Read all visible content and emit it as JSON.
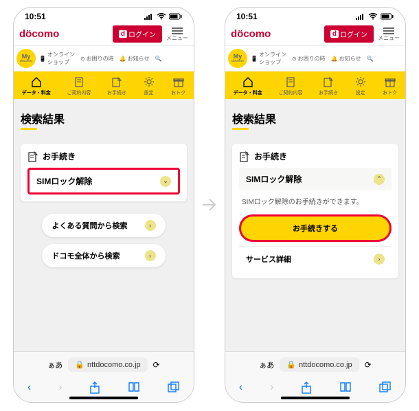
{
  "status": {
    "time": "10:51"
  },
  "header": {
    "logo": "döcomo",
    "login": "ログイン",
    "menu": "メニュー"
  },
  "subnav": {
    "my": "My",
    "mydomain": "docomo",
    "shop": "オンライン\nショップ",
    "help": "お困りの時",
    "news": "お知らせ"
  },
  "tabs": [
    "データ・料金",
    "ご契約内容",
    "お手続き",
    "設定",
    "おトク"
  ],
  "page": {
    "title": "検索結果",
    "section": "お手続き",
    "item": "SIMロック解除",
    "desc": "SIMロック解除のお手続きができます。",
    "cta": "お手続きする",
    "detail": "サービス詳細"
  },
  "pills": {
    "faq": "よくある質問から検索",
    "all": "ドコモ全体から検索"
  },
  "browser": {
    "aa": "ぁあ",
    "domain": "nttdocomo.co.jp",
    "lock": "🔒"
  }
}
